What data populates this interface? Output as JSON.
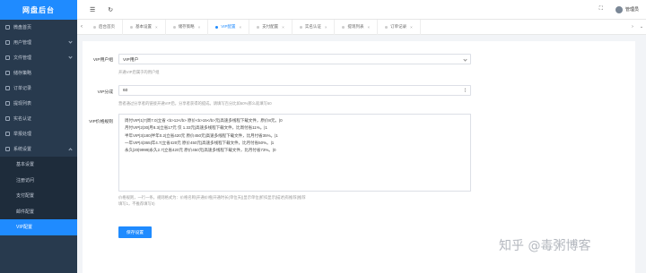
{
  "app": {
    "title": "网盘后台"
  },
  "sidebar": {
    "items": [
      {
        "label": "微盘首页",
        "icon": "home-icon"
      },
      {
        "label": "用户管理",
        "icon": "user-icon",
        "chevron": true
      },
      {
        "label": "文件管理",
        "icon": "file-icon",
        "chevron": true
      },
      {
        "label": "储存策略",
        "icon": "storage-icon"
      },
      {
        "label": "订单记录",
        "icon": "order-icon"
      },
      {
        "label": "提现列表",
        "icon": "withdraw-icon"
      },
      {
        "label": "实名认证",
        "icon": "verify-icon"
      },
      {
        "label": "举报处理",
        "icon": "report-icon"
      },
      {
        "label": "系统设置",
        "icon": "settings-icon",
        "chevron": true,
        "open": true
      }
    ],
    "sub_items": [
      {
        "label": "基本设置"
      },
      {
        "label": "注册访问"
      },
      {
        "label": "支付配置"
      },
      {
        "label": "邮件配置"
      },
      {
        "label": "VIP配置",
        "active": true
      }
    ]
  },
  "topbar": {
    "menu_icon": "☰",
    "refresh_icon": "↻",
    "fullscreen_icon": "⛶",
    "user_name": "管理员"
  },
  "tabs": [
    {
      "label": "后台首页"
    },
    {
      "label": "基本设置"
    },
    {
      "label": "储存策略"
    },
    {
      "label": "VIP配置",
      "active": true
    },
    {
      "label": "支付配置"
    },
    {
      "label": "实名认证"
    },
    {
      "label": "提现列表"
    },
    {
      "label": "订单记录"
    }
  ],
  "form": {
    "vip_group": {
      "label": "VIP用户组",
      "value": "VIP用户",
      "help": "开通VIP后属于的用户组"
    },
    "commission": {
      "label": "VIP分成",
      "value": "60",
      "help": "营者通过分享者的链接开通VIP后，分享者获得的提成。请填写百分比如60%那么就填写60"
    },
    "pricing": {
      "label": "VIP价格规则",
      "lines": [
        "周付VIP|1|7|周7.0|立省 <b>12</b> 原价<b>15</b>元|高速多线程下载文件，原价8元。|0",
        "月付VIP|2|30|月8.3|立省17元 仅 1.33元|高速多线程下载文件，比周付省11%。|1",
        "半年VIP|3|180|半年0.2|立省420元 原价450元|高速多线程下载文件，比月付省35%。|1",
        "一年VIP|4|365|年4.7|立省420元 原价450元|高速多线程下载文件，比月付省50%。|1",
        "永久|20|9999|永久2.7|立省420元 原价450元|高速多线程下载文件，比月付省73%。|0"
      ],
      "help_line1": "价格规则，一行一条。规则格式为：价格名称|开通价格|开通时长(单位天)|显示单位|折扣显示|描述|有推荐(推荐",
      "help_line2": "填写1，不推荐填写0)"
    },
    "save_label": "保存设置"
  },
  "watermark": "知乎 @毒粥博客"
}
